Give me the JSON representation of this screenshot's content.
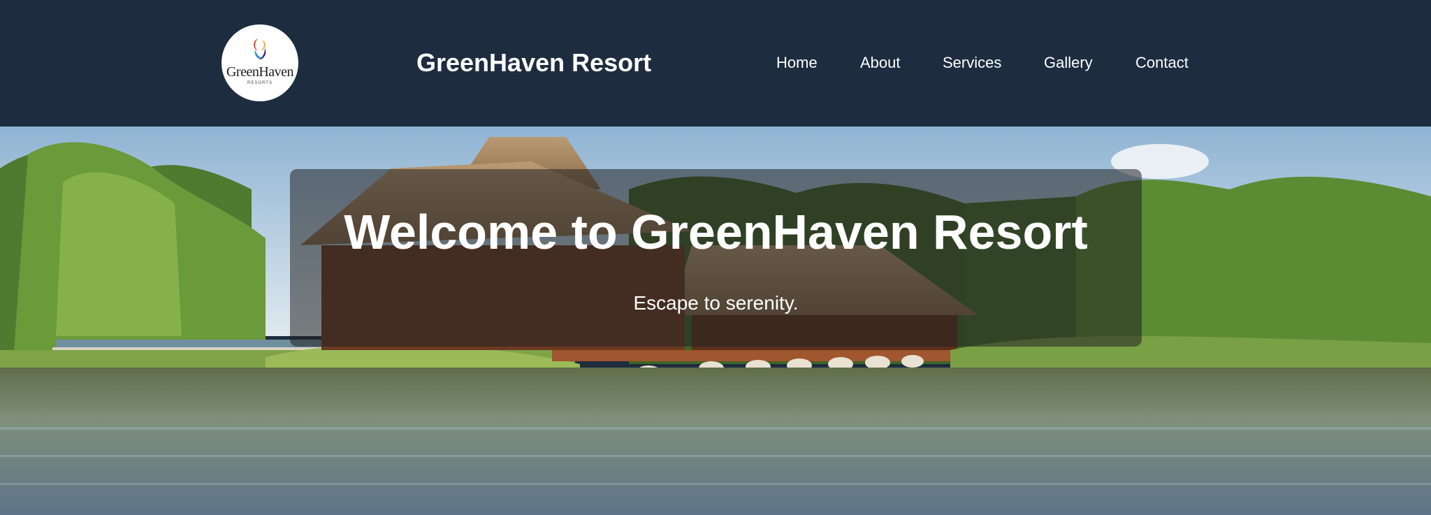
{
  "header": {
    "logo": {
      "text": "GreenHaven",
      "subtext": "RESORTS",
      "icon": "swirl-logo-icon"
    },
    "title": "GreenHaven Resort",
    "nav": [
      {
        "label": "Home"
      },
      {
        "label": "About"
      },
      {
        "label": "Services"
      },
      {
        "label": "Gallery"
      },
      {
        "label": "Contact"
      }
    ]
  },
  "hero": {
    "title": "Welcome to GreenHaven Resort",
    "subtitle": "Escape to serenity.",
    "image": "resort-lake-photo"
  },
  "colors": {
    "header_bg": "#1d2c3f",
    "text": "#ffffff",
    "overlay": "rgba(35,35,35,0.55)"
  }
}
